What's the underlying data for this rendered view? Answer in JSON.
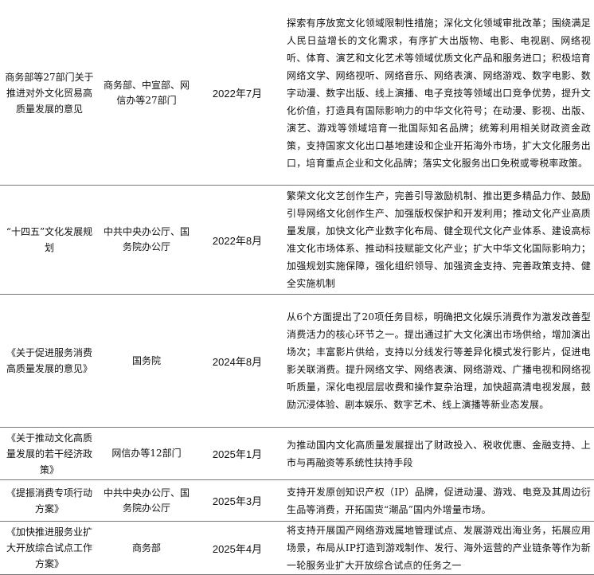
{
  "policies": [
    {
      "name": "商务部等27部门关于推进对外文化贸易高质量发展的意见",
      "issuer": "商务部、中宣部、网信办等27部门",
      "date": "2022年7月",
      "content": "探索有序放宽文化领域限制性措施；深化文化领域审批改革；围绕满足人民日益增长的文化需求，有序扩大出版物、电影、电视剧、网络视听、体育、演艺和文化艺术等领域优质文化产品和服务进口；积极培育网络文学、网络视听、网络音乐、网络表演、网络游戏、数字电影、数字动漫、数字出版、线上演播、电子竞技等领域出口竞争优势，提升文化价值，打造具有国际影响力的中华文化符号；在动漫、影视、出版、演艺、游戏等领域培育一批国际知名品牌；统筹利用相关财政资金政策，支持国家文化出口基地建设和企业开拓海外市场，扩大文化服务出口，培育重点企业和文化品牌；落实文化服务出口免税或零税率政策。"
    },
    {
      "name": "“十四五”文化发展规划",
      "issuer": "中共中央办公厅、国务院办公厅",
      "date": "2022年8月",
      "content": "繁荣文化文艺创作生产，完善引导激励机制、推出更多精品力作、鼓励引导网络文化创作生产、加强版权保护和开发利用；推动文化产业高质量发展，加快文化产业数字化布局、健全现代文化产业体系、建设高标准文化市场体系、推动科技赋能文化产业；扩大中华文化国际影响力；加强规划实施保障，强化组织领导、加强资金支持、完善政策支持、健全实施机制"
    },
    {
      "name": "《关于促进服务消费高质量发展的意见》",
      "issuer": "国务院",
      "date": "2024年8月",
      "content": "从6个方面提出了20项任务目标，明确把文化娱乐消费作为激发改善型消费活力的核心环节之一。提出通过扩大文化演出市场供给，增加演出场次；丰富影片供给，支持以分线发行等差异化模式发行影片，促进电影关联消费。提升网络文学、网络表演、网络游戏、广播电视和网络视听质量，深化电视层层收费和操作复杂治理，加快超高清电视发展，鼓励沉浸体验、剧本娱乐、数字艺术、线上演播等新业态发展。"
    },
    {
      "name": "《关于推动文化高质量发展的若干经济政策》",
      "issuer": "网信办等12部门",
      "date": "2025年1月",
      "content": "为推动国内文化高质量发展提出了财政投入、税收优惠、金融支持、上市与再融资等系统性扶持手段"
    },
    {
      "name": "《提振消费专项行动方案》",
      "issuer": "中共中央办公厅、国务院办公厅",
      "date": "2025年3月",
      "content": "支持开发原创知识产权（IP）品牌，促进动漫、游戏、电竞及其周边衍生品等消费，开拓国货“潮品”国内外增量市场。"
    },
    {
      "name": "《加快推进服务业扩大开放综合试点工作方案》",
      "issuer": "商务部",
      "date": "2025年4月",
      "content": "将支持开展国产网络游戏属地管理试点、发展游戏出海业务，拓展应用场景，布局从IP打造到游戏制作、发行、海外运营的产业链条等作为新一轮服务业扩大开放综合试点的任务之一"
    }
  ]
}
